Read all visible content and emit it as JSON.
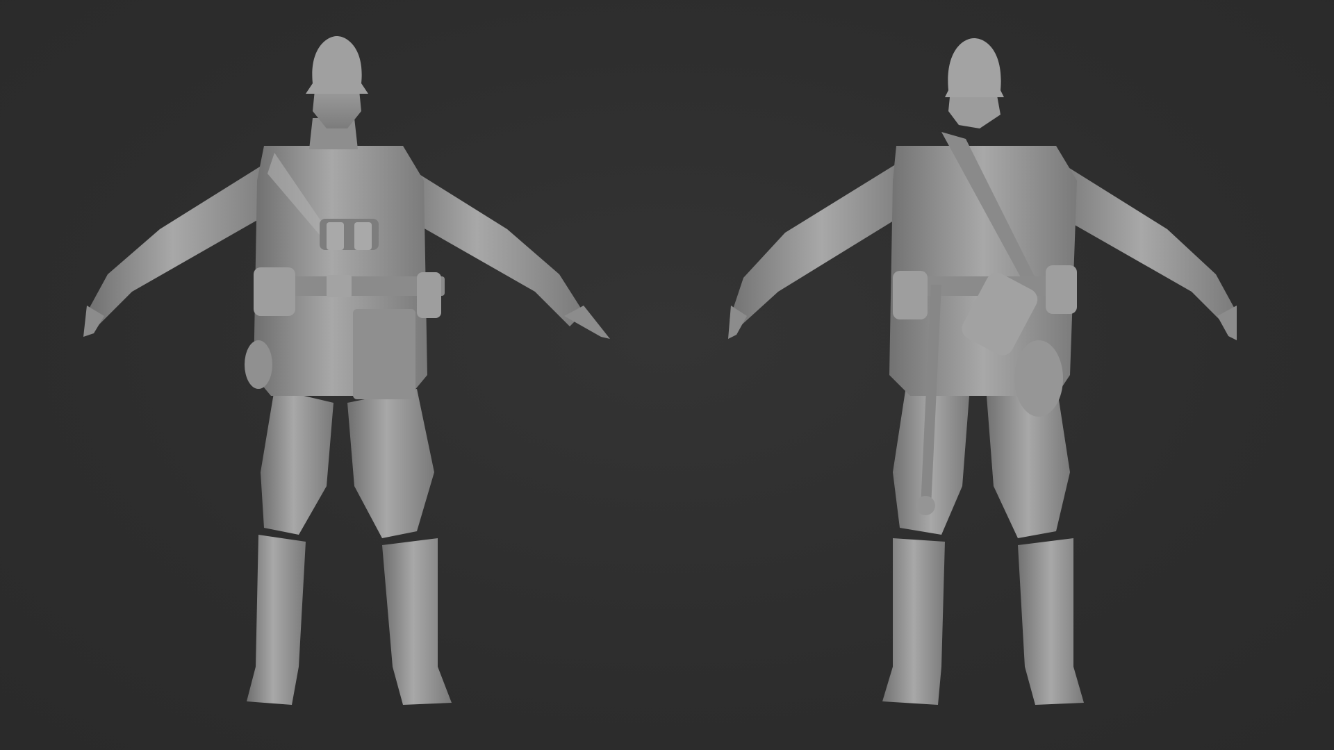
{
  "scene": {
    "background_color": "#2e2e2e",
    "model_color": "#9a9a9a",
    "views": [
      {
        "id": "front",
        "icon": "soldier-front-view-icon"
      },
      {
        "id": "back",
        "icon": "soldier-back-view-icon"
      }
    ]
  }
}
